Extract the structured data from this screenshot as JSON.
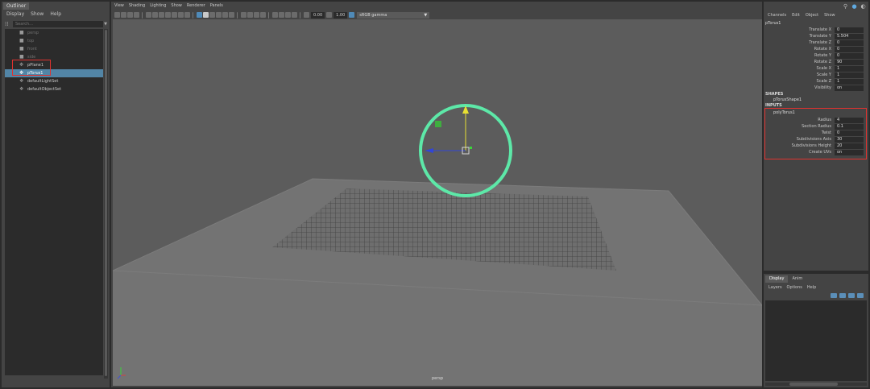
{
  "outliner": {
    "title": "Outliner",
    "menu": [
      "Display",
      "Show",
      "Help"
    ],
    "search_placeholder": "Search...",
    "items": [
      {
        "label": "persp",
        "icon": "camera-icon",
        "state": "dim"
      },
      {
        "label": "top",
        "icon": "camera-icon",
        "state": "dim"
      },
      {
        "label": "front",
        "icon": "camera-icon",
        "state": "dim"
      },
      {
        "label": "side",
        "icon": "camera-icon",
        "state": "dim"
      },
      {
        "label": "pPlane1",
        "icon": "mesh-icon",
        "state": "normal"
      },
      {
        "label": "pTorus1",
        "icon": "mesh-icon",
        "state": "selected"
      },
      {
        "label": "defaultLightSet",
        "icon": "set-icon",
        "state": "normal"
      },
      {
        "label": "defaultObjectSet",
        "icon": "set-icon",
        "state": "normal"
      }
    ]
  },
  "viewport": {
    "menu": [
      "View",
      "Shading",
      "Lighting",
      "Show",
      "Renderer",
      "Panels"
    ],
    "exposure": "0.00",
    "gamma": "1.00",
    "color_space": "sRGB gamma",
    "camera_label": "persp"
  },
  "channel_box": {
    "tabs": [
      "Channels",
      "Edit",
      "Object",
      "Show"
    ],
    "node": "pTorus1",
    "attributes": [
      {
        "name": "Translate X",
        "value": "0"
      },
      {
        "name": "Translate Y",
        "value": "5.504"
      },
      {
        "name": "Translate Z",
        "value": "0"
      },
      {
        "name": "Rotate X",
        "value": "0"
      },
      {
        "name": "Rotate Y",
        "value": "0"
      },
      {
        "name": "Rotate Z",
        "value": "90"
      },
      {
        "name": "Scale X",
        "value": "1"
      },
      {
        "name": "Scale Y",
        "value": "1"
      },
      {
        "name": "Scale Z",
        "value": "1"
      },
      {
        "name": "Visibility",
        "value": "on"
      }
    ],
    "shapes_label": "SHAPES",
    "shape_node": "pTorusShape1",
    "inputs_label": "INPUTS",
    "input_node": "polyTorus1",
    "input_attributes": [
      {
        "name": "Radius",
        "value": "4"
      },
      {
        "name": "Section Radius",
        "value": "0.1"
      },
      {
        "name": "Twist",
        "value": "0"
      },
      {
        "name": "Subdivisions Axis",
        "value": "30"
      },
      {
        "name": "Subdivisions Height",
        "value": "20"
      },
      {
        "name": "Create UVs",
        "value": "on"
      }
    ]
  },
  "layer_editor": {
    "tabs": [
      "Display",
      "Anim"
    ],
    "menu": [
      "Layers",
      "Options",
      "Help"
    ]
  },
  "colors": {
    "selection": "#5285a6",
    "highlight_box": "#e0322f",
    "torus": "#5de8a8"
  }
}
